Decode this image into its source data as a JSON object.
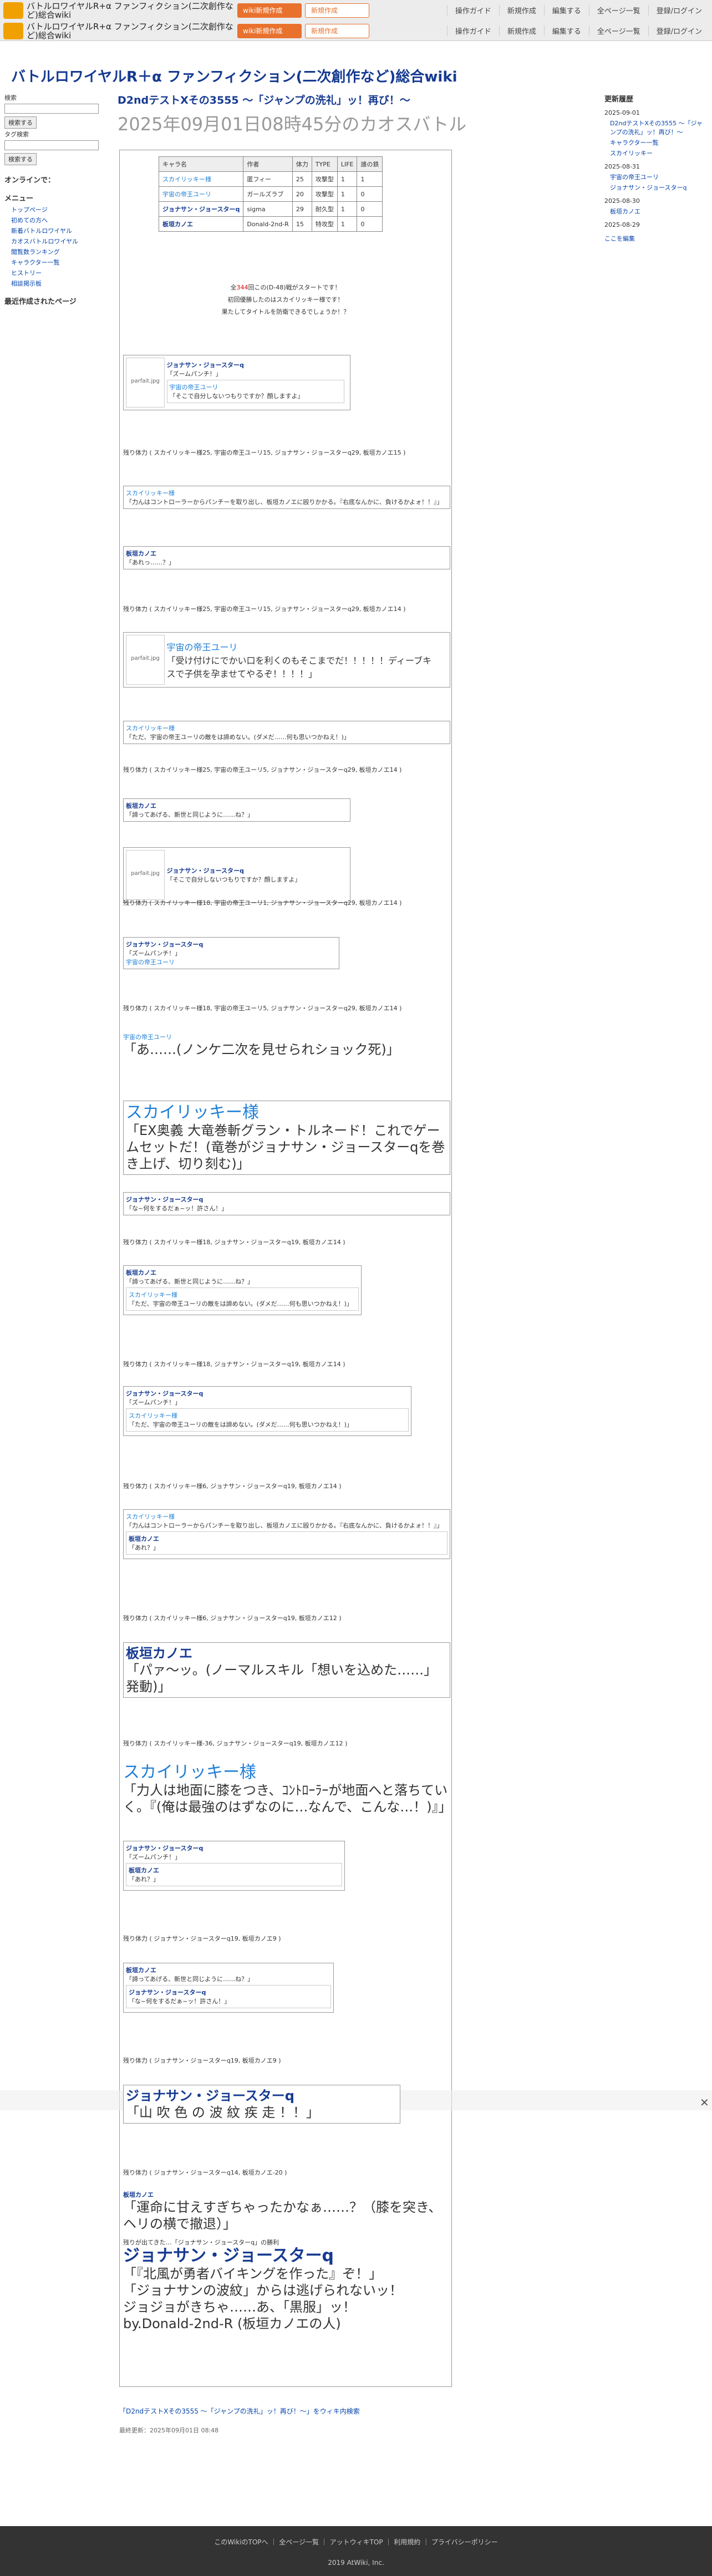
{
  "topbar": {
    "title": "バトルロワイヤルR+α ファンフィクション(二次創作など)総合wiki",
    "btn_new": "wiki新規作成",
    "btn_new2": "新規作成",
    "links": [
      "操作ガイド",
      "新規作成",
      "編集する",
      "全ページ一覧",
      "登録/ログイン"
    ]
  },
  "site_title": "バトルロワイヤルR＋α ファンフィクション(二次創作など)総合wiki",
  "page": {
    "title": "D2ndテストXその3555 〜「ジャンプの洗礼」ッ！再び！〜",
    "subtitle": "2025年09月01日08時45分のカオスバトル"
  },
  "left": {
    "search_label": "検索",
    "search_btn": "検索する",
    "tags_label": "タグ検索",
    "tags_btn": "検索する",
    "online_label": "オンラインで：",
    "menu": "メニュー",
    "items": [
      "トップページ",
      "初めての方へ",
      "新着バトルロワイヤル",
      "カオスバトルロワイヤル",
      "閲覧数ランキング",
      "キャラクター一覧",
      "ヒストリー",
      "相談掲示板"
    ],
    "recent_label": "最近作成されたページ"
  },
  "right": {
    "title": "更新履歴",
    "dates": [
      "2025-09-01",
      "2025-08-31",
      "2025-08-30",
      "2025-08-29"
    ],
    "items": [
      "D2ndテストXその3555 〜「ジャンプの洗礼」ッ！再び！〜",
      "キャラクター一覧",
      "スカイリッキー",
      "宇宙の帝王ユーリ",
      "ジョナサン・ジョースターq",
      "板垣カノエ"
    ],
    "more": "ここを編集"
  },
  "table": {
    "header": [
      "キャラ名",
      "作者",
      "体力",
      "TYPE",
      "LIFE",
      "誰の鉄"
    ],
    "rows": [
      [
        "スカイリッキー様",
        "匿フィー",
        "25",
        "攻撃型",
        "1",
        "1"
      ],
      [
        "宇宙の帝王ユーリ",
        "ガールズラブ",
        "20",
        "攻撃型",
        "1",
        "0"
      ],
      [
        "ジョナサン・ジョースターq",
        "sigma",
        "29",
        "耐久型",
        "1",
        "0"
      ],
      [
        "板垣カノエ",
        "Donald-2nd-R",
        "15",
        "特攻型",
        "1",
        "0"
      ]
    ]
  },
  "intro": [
    "全",
    "344",
    "回この(D-48)戦がスタートです！",
    "初回優勝したのはスカイリッキー様です！",
    "果たしてタイトルを防衛できるでしょうか！？"
  ],
  "turn_lines": [
    "残り体力 ( スカイリッキー様25, 宇宙の帝王ユーリ15, ジョナサン・ジョースターq29, 板垣カノエ15 )",
    "残り体力 ( スカイリッキー様25, 宇宙の帝王ユーリ15, ジョナサン・ジョースターq29, 板垣カノエ14 )",
    "残り体力 ( スカイリッキー様25, 宇宙の帝王ユーリ5, ジョナサン・ジョースターq29, 板垣カノエ14 )",
    "残り体力 ( スカイリッキー様18, 宇宙の帝王ユーリ1, ジョナサン・ジョースターq29, 板垣カノエ14 )",
    "残り体力 ( スカイリッキー様18, 宇宙の帝王ユーリ5, ジョナサン・ジョースターq29, 板垣カノエ14 )",
    "残り体力 ( スカイリッキー様18, ジョナサン・ジョースターq19, 板垣カノエ14 )",
    "残り体力 ( スカイリッキー様18, ジョナサン・ジョースターq19, 板垣カノエ14 )",
    "残り体力 ( スカイリッキー様6, ジョナサン・ジョースターq19, 板垣カノエ14 )",
    "残り体力 ( スカイリッキー様6, ジョナサン・ジョースターq19, 板垣カノエ12 )",
    "残り体力 ( スカイリッキー様-36, ジョナサン・ジョースターq19, 板垣カノエ12 )",
    "残り体力 ( ジョナサン・ジョースターq19, 板垣カノエ9 )",
    "残り体力 ( ジョナサン・ジョースターq19, 板垣カノエ9 )",
    "残り体力 ( ジョナサン・ジョースターq14, 板垣カノエ-20 )"
  ],
  "quotes": {
    "q1": "「ズームパンチ！」",
    "q2": "「そこで自分しないつもりですか？顔しますよ」",
    "q3": "「力んはコントローラーからパンチーを取り出し、板垣カノエに殴りかかる。『右底なんかに、負けるかよォ！！』」",
    "q4": "「あれっ……？」",
    "q5": "「受け付けにでかい口を利くのもそこまでだ！！！！！ディーブキスで子供を孕ませてやるぞ！！！！」",
    "q6": "「ただ、宇宙の帝王ユーリの敵をは諦めない。(ダメだ……何も思いつかねえ！)」",
    "q7": "「諦ってあげる、新世と同じように……ね？」",
    "q8": "「そこで自分しないつもりですか？顔しますよ」",
    "q9": "「あ……(ノンケ二次を見せられショック死)」",
    "q10": "「EX奥義 大竜巻斬グラン・トルネード！これでゲームセットだ！(竜巻がジョナサン・ジョースターqを巻き上げ、切り刻む)」",
    "q11": "「な~何をするだぁ~ッ！許さん！」",
    "q12": "「ズームパンチ！」",
    "q13": "「あれ？」",
    "q14": "「パァ〜ッ。(ノーマルスキル「想いを込めた……」発動)」",
    "q15": "「力人は地面に膝をつき、ｺﾝﾄﾛｰﾗｰが地面へと落ちていく。『(俺は最強のはずなのに…なんで、こんな…！)』」",
    "q16": "「山 吹 色 の 波 紋 疾 走 ！！」",
    "q17": "「運命に甘えすぎちゃったかなぁ……？（膝を突き、ヘリの横で撤退）」",
    "q18": "「『北風が勇者バイキングを作った』ぞ！」",
    "q19": "「ジョナサンの波紋」からは逃げられないッ！",
    "q20": "ジョジョがきちゃ……あ、「黒服」ッ！",
    "q21": "by.Donald-2nd-R (板垣カノエの人)"
  },
  "names": {
    "sky": "スカイリッキー様",
    "emp": "宇宙の帝王ユーリ",
    "jo": "ジョナサン・ジョースターq",
    "kan": "板垣カノエ"
  },
  "winner": {
    "line1": "残りが出てきた…「ジョナサン・ジョースターq」の勝利",
    "title": "ジョナサン・ジョースターq"
  },
  "footer": {
    "edit_link": "「D2ndテストXその3555 〜「ジャンプの洗礼」ッ！再び！〜」をウィキ内検索",
    "last_updated": "最終更新：2025年09月01日 08:48",
    "links": [
      "このWikiのTOPへ",
      "全ページ一覧",
      "アットウィキTOP",
      "利用規約",
      "プライバシーポリシー"
    ],
    "copyright": "2019 AtWiki, Inc."
  }
}
